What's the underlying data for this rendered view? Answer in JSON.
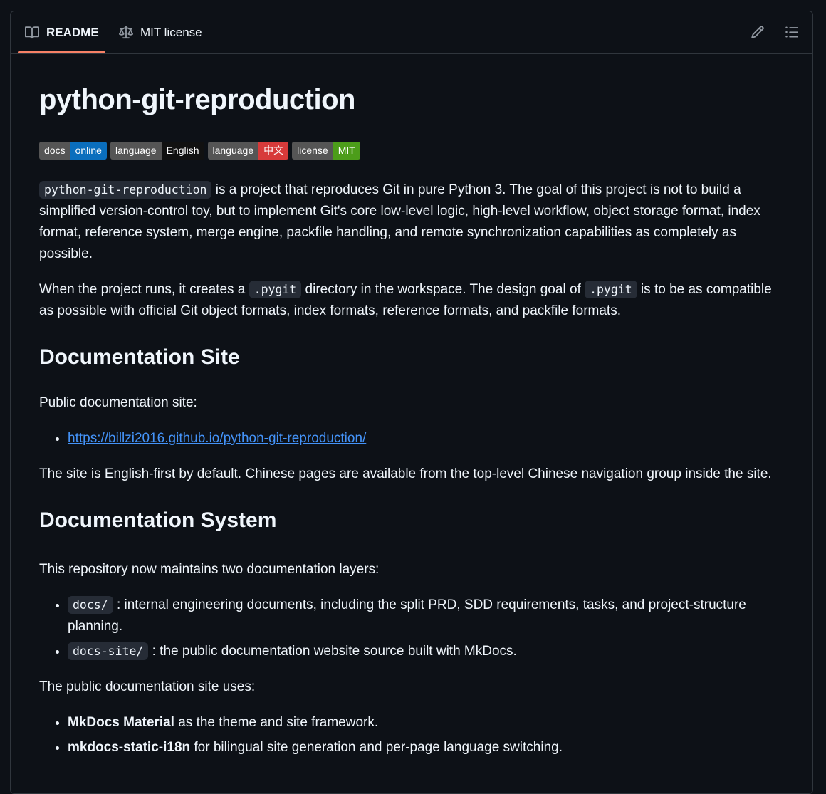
{
  "tabs": {
    "readme": "README",
    "license": "MIT license"
  },
  "readme": {
    "title": "python-git-reproduction",
    "badges": [
      {
        "key": "docs",
        "value": "online"
      },
      {
        "key": "language",
        "value": "English"
      },
      {
        "key": "language",
        "value": "中文"
      },
      {
        "key": "license",
        "value": "MIT"
      }
    ],
    "intro": {
      "code": "python-git-reproduction",
      "text": " is a project that reproduces Git in pure Python 3. The goal of this project is not to build a simplified version-control toy, but to implement Git's core low-level logic, high-level workflow, object storage format, index format, reference system, merge engine, packfile handling, and remote synchronization capabilities as completely as possible."
    },
    "pygit": {
      "text1": "When the project runs, it creates a ",
      "code1": ".pygit",
      "text2": " directory in the workspace. The design goal of ",
      "code2": ".pygit",
      "text3": " is to be as compatible as possible with official Git object formats, index formats, reference formats, and packfile formats."
    },
    "doc_site": {
      "heading": "Documentation Site",
      "lead": "Public documentation site:",
      "link": "https://billzi2016.github.io/python-git-reproduction/",
      "note": "The site is English-first by default. Chinese pages are available from the top-level Chinese navigation group inside the site."
    },
    "doc_system": {
      "heading": "Documentation System",
      "lead": "This repository now maintains two documentation layers:",
      "items": [
        {
          "code": "docs/",
          "text": " : internal engineering documents, including the split PRD, SDD requirements, tasks, and project-structure planning."
        },
        {
          "code": "docs-site/",
          "text": " : the public documentation website source built with MkDocs."
        }
      ],
      "uses_lead": "The public documentation site uses:",
      "uses": [
        {
          "bold": "MkDocs Material",
          "text": " as the theme and site framework."
        },
        {
          "bold": "mkdocs-static-i18n",
          "text": " for bilingual site generation and per-page language switching."
        }
      ]
    }
  }
}
